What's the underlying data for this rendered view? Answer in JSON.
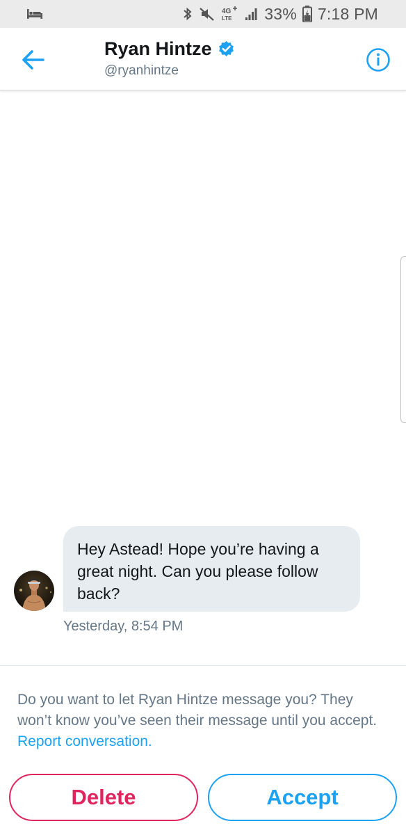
{
  "status_bar": {
    "battery": "33%",
    "time": "7:18 PM",
    "network": "4G LTE"
  },
  "header": {
    "name": "Ryan Hintze",
    "handle": "@ryanhintze"
  },
  "conversation": {
    "message": "Hey Astead! Hope you’re having a great night. Can you please follow back?",
    "timestamp": "Yesterday, 8:54 PM"
  },
  "request": {
    "prompt": "Do you want to let Ryan Hintze message you? They won’t know you’ve seen their message until you accept.",
    "report_link": "Report conversation."
  },
  "actions": {
    "delete_label": "Delete",
    "accept_label": "Accept"
  },
  "colors": {
    "accent": "#1da1f2",
    "delete": "#e0245e",
    "bubble": "#e6ecf0",
    "secondary_text": "#657786"
  }
}
